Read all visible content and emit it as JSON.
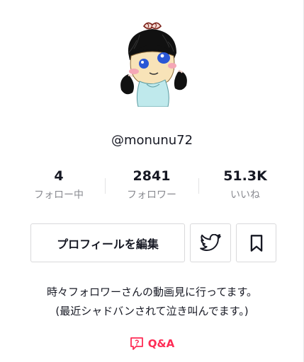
{
  "profile": {
    "handle": "@monunu72"
  },
  "stats": [
    {
      "value": "4",
      "label": "フォロー中"
    },
    {
      "value": "2841",
      "label": "フォロワー"
    },
    {
      "value": "51.3K",
      "label": "いいね"
    }
  ],
  "actions": {
    "edit_label": "プロフィールを編集",
    "twitter_icon": "twitter-icon",
    "bookmark_icon": "bookmark-icon"
  },
  "bio": {
    "line1": "時々フォロワーさんの動画見に行ってます。",
    "line2": "(最近シャドバンされて泣き叫んでます。)"
  },
  "qa": {
    "label": "Q&A",
    "icon": "question-chat-icon",
    "color": "#fe2c55"
  }
}
